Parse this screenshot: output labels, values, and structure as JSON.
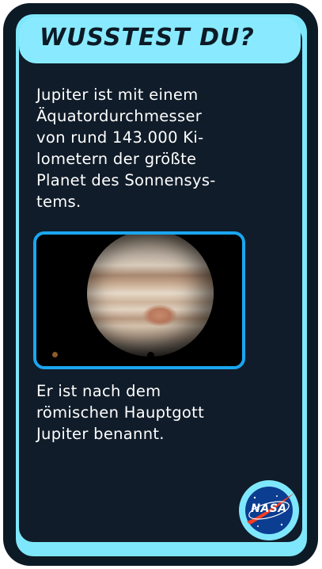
{
  "title": "WUSSTEST DU?",
  "paragraph1": [
    "Jupiter ist mit einem",
    "Äquatordurchmesser",
    "von rund 143.000 Ki-",
    "lometern der größte",
    "Planet des Sonnensys-",
    "tems."
  ],
  "paragraph2": [
    "Er ist nach dem",
    "römischen Hauptgott",
    "Jupiter benannt."
  ],
  "logo": {
    "text": "NASA"
  },
  "colors": {
    "background": "#0c1a26",
    "accent_cyan": "#7fe7fb",
    "photo_border": "#1aa6ef",
    "nasa_blue": "#0b3d91",
    "nasa_red": "#fc3d21"
  }
}
